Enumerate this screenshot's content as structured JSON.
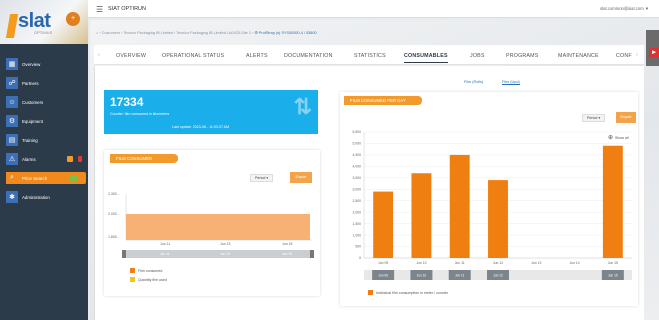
{
  "logo": {
    "text": "slat",
    "subtext": "OPTIMUS",
    "badge": "+"
  },
  "topbar": {
    "title": "SIAT OPTIRUN",
    "user": "slat.common@siat.com ▼"
  },
  "nav": [
    {
      "label": "Overview",
      "icon": "dashboard-icon"
    },
    {
      "label": "Partners",
      "icon": "handshake-icon"
    },
    {
      "label": "Customers",
      "icon": "users-icon"
    },
    {
      "label": "Equipment",
      "icon": "gear-icon"
    },
    {
      "label": "Training",
      "icon": "book-icon"
    },
    {
      "label": "Alarms",
      "icon": "warning-icon",
      "badge": ""
    },
    {
      "label": "Price Search",
      "icon": "search-icon",
      "badge": ""
    },
    {
      "label": "Administration",
      "icon": "settings-icon"
    }
  ],
  "breadcrumb": {
    "prefix": "⌂ › Customers › Tecnico Packaging IB Limited › Tecnico Packaging IB Limited LA0433-Site 1 ›",
    "last": "⚙ ProfStrap (s) SYS00000-4 / 53800"
  },
  "tabs": [
    "OVERVIEW",
    "OPERATIONAL STATUS",
    "ALERTS",
    "DOCUMENTATION",
    "STATISTICS",
    "CONSUMABLES",
    "JOBS",
    "PROGRAMS",
    "MAINTENANCE",
    "CONF"
  ],
  "active_tab": "CONSUMABLES",
  "subtabs": [
    "Film (Rolls)",
    "Film (Upd)"
  ],
  "kpi": {
    "value": "17334",
    "description": "Counter: film consumed in kilometres",
    "update": "Last update: 2023-06 - 11:03:37 AM"
  },
  "film_card": {
    "title": "FILM CONSUMED",
    "period_btn": "Period ▾",
    "export_btn": "Export",
    "y_ticks": [
      "2,300 -",
      "2,000 -",
      "1,800 -"
    ],
    "x_ticks": [
      "Jun 11",
      "Jun 13",
      "Jun 15"
    ],
    "nav_ticks": [
      "Jun 11",
      "Jun 13",
      "Jun 15"
    ],
    "legend": [
      "Film consumed",
      "Quantity film used"
    ]
  },
  "chart_card": {
    "title": "FILM CONSUMED PER DAY",
    "period_btn": "Period ▾",
    "export_btn": "Export",
    "zoom_btn": "Show all",
    "legend": "Individual film consumption in meter / counter"
  },
  "chart_data": {
    "type": "bar",
    "categories": [
      "Jun 09",
      "Jun 10",
      "Jun 11",
      "Jun 12",
      "Jun 13",
      "Jun 14",
      "Jun 15"
    ],
    "values": [
      2900,
      3700,
      4500,
      3400,
      0,
      0,
      4900
    ],
    "ylim": [
      0,
      5500
    ],
    "yticks": [
      0,
      500,
      1000,
      1500,
      2000,
      2500,
      3000,
      3500,
      4000,
      4500,
      5000,
      5500
    ],
    "ytick_labels": [
      "0",
      "500",
      "1,000",
      "1,500",
      "2,000",
      "2,500",
      "3,000",
      "3,500",
      "4,000",
      "4,500",
      "5,000",
      "5,500"
    ],
    "series": [
      {
        "name": "Individual film consumption in meter / counter",
        "values": [
          2900,
          3700,
          4500,
          3400,
          0,
          0,
          4900
        ]
      }
    ],
    "color": "#f07f12",
    "navigator_labels": [
      "Jun 09",
      "Jun 10",
      "Jun 11",
      "Jun 12",
      "Jun 15"
    ]
  }
}
